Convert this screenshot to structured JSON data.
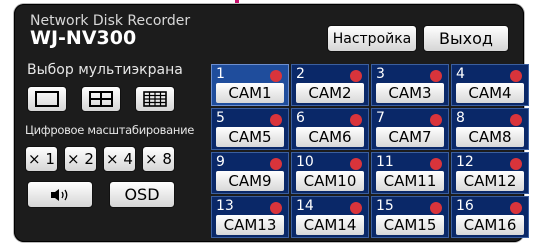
{
  "brand": {
    "line1": "Network Disk Recorder",
    "line2": "WJ-NV300"
  },
  "header": {
    "settings_label": "Настройка",
    "exit_label": "Выход"
  },
  "multiscreen": {
    "label": "Выбор мультиэкрана",
    "layouts": [
      {
        "icon": "single-screen-icon"
      },
      {
        "icon": "quad-screen-icon"
      },
      {
        "icon": "sixteen-screen-icon"
      }
    ]
  },
  "zoom": {
    "label": "Цифровое масштабирование",
    "buttons": [
      "× 1",
      "× 2",
      "× 4",
      "× 8"
    ]
  },
  "audio": {
    "icon": "speaker-icon"
  },
  "osd": {
    "label": "OSD"
  },
  "colors": {
    "accent": "#c8116e",
    "cell_bg": "#0a2868",
    "cell_selected": "#1f4d9c",
    "rec_dot": "#d9343b"
  },
  "cameras": [
    {
      "num": "1",
      "label": "CAM1"
    },
    {
      "num": "2",
      "label": "CAM2"
    },
    {
      "num": "3",
      "label": "CAM3"
    },
    {
      "num": "4",
      "label": "CAM4"
    },
    {
      "num": "5",
      "label": "CAM5"
    },
    {
      "num": "6",
      "label": "CAM6"
    },
    {
      "num": "7",
      "label": "CAM7"
    },
    {
      "num": "8",
      "label": "CAM8"
    },
    {
      "num": "9",
      "label": "CAM9"
    },
    {
      "num": "10",
      "label": "CAM10"
    },
    {
      "num": "11",
      "label": "CAM11"
    },
    {
      "num": "12",
      "label": "CAM12"
    },
    {
      "num": "13",
      "label": "CAM13"
    },
    {
      "num": "14",
      "label": "CAM14"
    },
    {
      "num": "15",
      "label": "CAM15"
    },
    {
      "num": "16",
      "label": "CAM16"
    }
  ]
}
